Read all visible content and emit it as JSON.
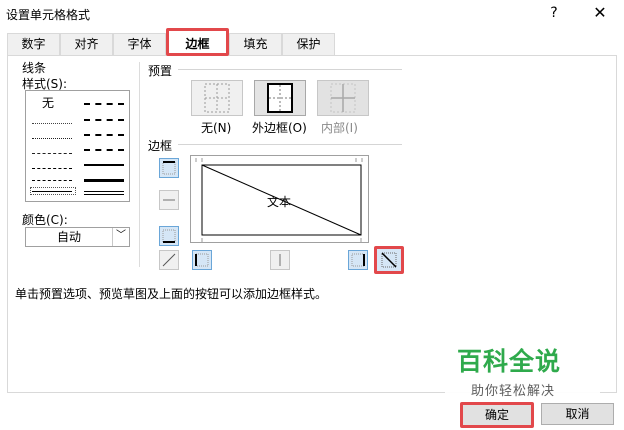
{
  "window": {
    "title": "设置单元格格式",
    "help": "?",
    "close": "✕"
  },
  "tabs": [
    "数字",
    "对齐",
    "字体",
    "边框",
    "填充",
    "保护"
  ],
  "line": {
    "group_label": "线条",
    "style_label": "样式(S):",
    "none_label": "无",
    "color_label": "颜色(C):",
    "color_value": "自动"
  },
  "preset": {
    "label": "预置",
    "none": "无(N)",
    "outline": "外边框(O)",
    "inside": "内部(I)"
  },
  "border": {
    "label": "边框",
    "preview_text": "文本"
  },
  "hint": "单击预置选项、预览草图及上面的按钮可以添加边框样式。",
  "footer": {
    "ok": "确定",
    "cancel": "取消"
  },
  "watermark": {
    "title": "百科全说",
    "subtitle": "助你轻松解决"
  },
  "colors": {
    "highlight": "#e2484b",
    "watermark_green": "#2faa4c"
  }
}
